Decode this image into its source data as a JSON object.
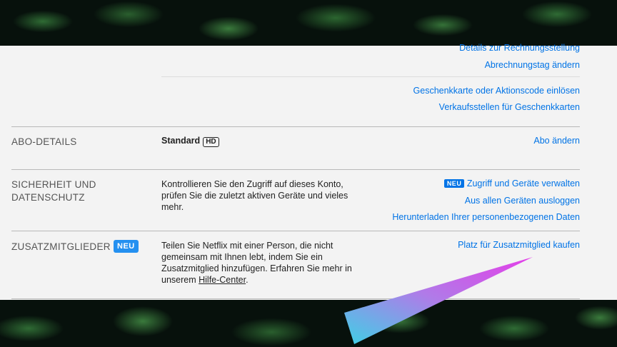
{
  "billing": {
    "details_link": "Details zur Rechnungsstellung",
    "change_billing_day_link": "Abrechnungstag ändern",
    "redeem_gift_link": "Geschenkkarte oder Aktionscode einlösen",
    "gift_retailers_link": "Verkaufsstellen für Geschenkkarten"
  },
  "plan_details": {
    "title": "ABO-DETAILS",
    "plan_name": "Standard",
    "plan_badge": "HD",
    "change_plan_link": "Abo ändern"
  },
  "security": {
    "title_line1": "SICHERHEIT UND",
    "title_line2": "DATENSCHUTZ",
    "description_line1": "Kontrollieren Sie den Zugriff auf dieses Konto,",
    "description_line2": "prüfen Sie die zuletzt aktiven Geräte und vieles",
    "description_line3": "mehr.",
    "new_badge": "NEU",
    "manage_access_link": "Zugriff und Geräte verwalten",
    "signout_all_link": "Aus allen Geräten ausloggen",
    "download_data_link": "Herunterladen Ihrer personenbezogenen Daten"
  },
  "extra_members": {
    "title": "ZUSATZMITGLIEDER",
    "new_badge": "NEU",
    "description_line1": "Teilen Sie Netflix mit einer Person, die nicht",
    "description_line2": "gemeinsam mit Ihnen lebt, indem Sie ein",
    "description_line3": "Zusatzmitglied hinzufügen. Erfahren Sie mehr in",
    "description_line4_prefix": "unserem ",
    "help_center_link": "Hilfe-Center",
    "description_line4_suffix": ".",
    "buy_slot_link": "Platz für Zusatzmitglied kaufen"
  },
  "colors": {
    "link": "#0073e6",
    "panel_background": "#f3f3f3",
    "badge": "#0073e6"
  }
}
